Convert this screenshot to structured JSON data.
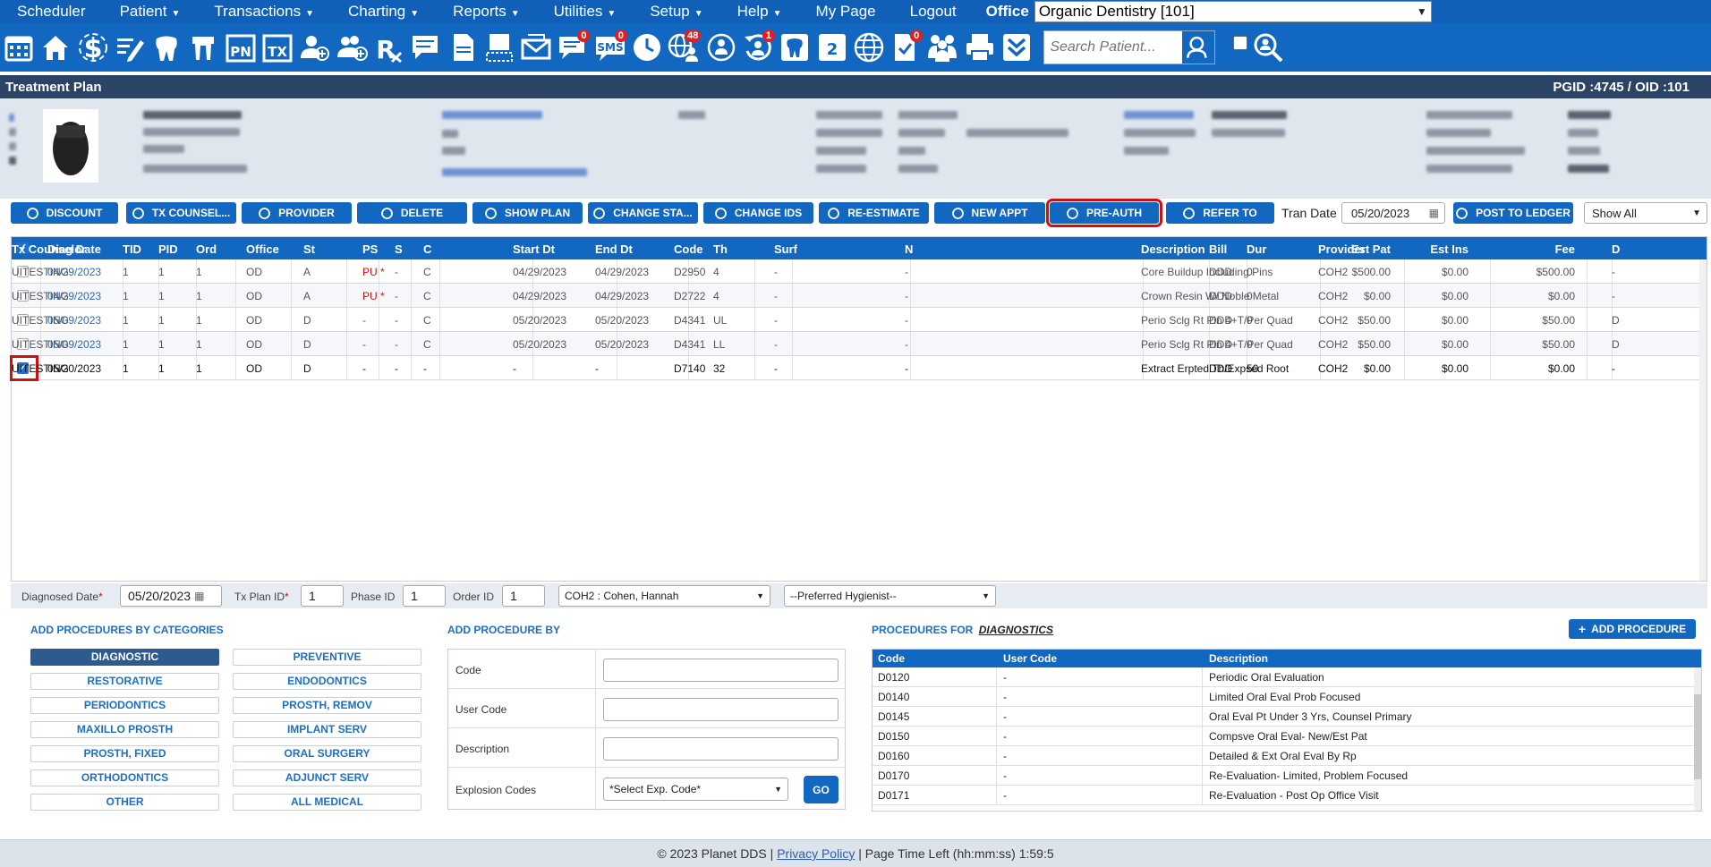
{
  "menu": {
    "items": [
      {
        "label": "Scheduler",
        "caret": false
      },
      {
        "label": "Patient",
        "caret": true
      },
      {
        "label": "Transactions",
        "caret": true
      },
      {
        "label": "Charting",
        "caret": true
      },
      {
        "label": "Reports",
        "caret": true
      },
      {
        "label": "Utilities",
        "caret": true
      },
      {
        "label": "Setup",
        "caret": true
      },
      {
        "label": "Help",
        "caret": true
      },
      {
        "label": "My Page",
        "caret": false
      },
      {
        "label": "Logout",
        "caret": false
      }
    ],
    "office_label": "Office",
    "office_value": "Organic Dentistry [101]"
  },
  "toolbar": {
    "icons": [
      "calendar-icon",
      "home-icon",
      "dollar-icon",
      "pencil-list-icon",
      "tooth-icon",
      "tooth-roots-icon",
      "pn-icon",
      "tx-icon",
      "add-patient-icon",
      "add-family-icon",
      "rx-icon",
      "notes-icon",
      "document-icon",
      "scan-icon",
      "mail-icon",
      "chat-icon",
      "sms-icon",
      "clock-icon",
      "globe-people-icon",
      "network-icon",
      "refresh-user-icon",
      "tooth-alt-icon",
      "tooth-2-icon",
      "globe-icon",
      "document-check-icon",
      "people-icon",
      "printer-icon",
      "chevron-down-icon"
    ],
    "badges": {
      "chat-icon": "0",
      "sms-icon": "0",
      "globe-people-icon": "48",
      "refresh-user-icon": "1",
      "document-check-icon": "0"
    },
    "search_placeholder": "Search Patient..."
  },
  "titlebar": {
    "title": "Treatment Plan",
    "ids": "PGID :4745  /  OID :101"
  },
  "actions": [
    {
      "name": "discount-button",
      "label": "DISCOUNT"
    },
    {
      "name": "tx-counselor-button",
      "label": "TX COUNSEL..."
    },
    {
      "name": "provider-button",
      "label": "PROVIDER"
    },
    {
      "name": "delete-button",
      "label": "DELETE"
    },
    {
      "name": "show-plan-button",
      "label": "SHOW PLAN"
    },
    {
      "name": "change-status-button",
      "label": "CHANGE STA..."
    },
    {
      "name": "change-ids-button",
      "label": "CHANGE IDS"
    },
    {
      "name": "re-estimate-button",
      "label": "RE-ESTIMATE"
    },
    {
      "name": "new-appt-button",
      "label": "NEW APPT"
    },
    {
      "name": "pre-auth-button",
      "label": "PRE-AUTH"
    },
    {
      "name": "refer-to-button",
      "label": "REFER TO"
    },
    {
      "name": "post-to-ledger-button",
      "label": "POST TO LEDGER"
    }
  ],
  "tran_date": {
    "label": "Tran Date",
    "value": "05/20/2023"
  },
  "show_filter": "Show All",
  "grid": {
    "headers": [
      "Diag Date",
      "TID",
      "PID",
      "Ord",
      "Office",
      "St",
      "PS",
      "S",
      "C",
      "Start Dt",
      "End Dt",
      "Code",
      "Th",
      "Surf",
      "N",
      "Description",
      "Bill",
      "Dur",
      "Provider",
      "Est Pat",
      "Est Ins",
      "Fee",
      "D",
      "Tx Counselor"
    ],
    "rows": [
      {
        "checked": false,
        "cells": [
          "04/29/2023",
          "1",
          "1",
          "1",
          "OD",
          "A",
          "PU *",
          "-",
          "C",
          "04/29/2023",
          "04/29/2023",
          "D2950",
          "4",
          "-",
          "-",
          "Core Buildup Including Pins",
          "DDD",
          "0",
          "COH2",
          "$500.00",
          "$0.00",
          "$500.00",
          "-",
          "UITESTING"
        ]
      },
      {
        "checked": false,
        "cells": [
          "04/29/2023",
          "1",
          "1",
          "1",
          "OD",
          "A",
          "PU *",
          "-",
          "C",
          "04/29/2023",
          "04/29/2023",
          "D2722",
          "4",
          "-",
          "-",
          "Crown Resin W/ Noble Metal",
          "DDD",
          "0",
          "COH2",
          "$0.00",
          "$0.00",
          "$0.00",
          "-",
          "UITESTING"
        ]
      },
      {
        "checked": false,
        "cells": [
          "05/09/2023",
          "1",
          "1",
          "1",
          "OD",
          "D",
          "-",
          "-",
          "C",
          "05/20/2023",
          "05/20/2023",
          "D4341",
          "UL",
          "-",
          "-",
          "Perio Sclg Rt Pln 4+T/Per Quad",
          "DDD",
          "0",
          "COH2",
          "$50.00",
          "$0.00",
          "$50.00",
          "D",
          "UITESTING"
        ]
      },
      {
        "checked": false,
        "cells": [
          "05/09/2023",
          "1",
          "1",
          "1",
          "OD",
          "D",
          "-",
          "-",
          "C",
          "05/20/2023",
          "05/20/2023",
          "D4341",
          "LL",
          "-",
          "-",
          "Perio Sclg Rt Pln 4+T/Per Quad",
          "DDD",
          "0",
          "COH2",
          "$50.00",
          "$0.00",
          "$50.00",
          "D",
          "UITESTING"
        ]
      },
      {
        "checked": true,
        "cells": [
          "05/20/2023",
          "1",
          "1",
          "1",
          "OD",
          "D",
          "-",
          "-",
          "-",
          "-",
          "-",
          "D7140",
          "32",
          "-",
          "-",
          "Extract Erpted Th/Expsed Root",
          "DDD",
          "50",
          "COH2",
          "$0.00",
          "$0.00",
          "$0.00",
          "-",
          "UITESTING"
        ]
      }
    ]
  },
  "form": {
    "diag_date_label": "Diagnosed Date",
    "diag_date": "05/20/2023",
    "tx_plan_label": "Tx Plan ID",
    "tx_plan": "1",
    "phase_label": "Phase ID",
    "phase": "1",
    "order_label": "Order ID",
    "order": "1",
    "provider": "COH2 : Cohen, Hannah",
    "hygienist": "--Preferred Hygienist--"
  },
  "categories": {
    "title": "ADD PROCEDURES BY CATEGORIES",
    "left": [
      "DIAGNOSTIC",
      "RESTORATIVE",
      "PERIODONTICS",
      "MAXILLO PROSTH",
      "PROSTH, FIXED",
      "ORTHODONTICS",
      "OTHER"
    ],
    "right": [
      "PREVENTIVE",
      "ENDODONTICS",
      "PROSTH, REMOV",
      "IMPLANT SERV",
      "ORAL SURGERY",
      "ADJUNCT SERV",
      "ALL MEDICAL"
    ]
  },
  "addby": {
    "title": "ADD PROCEDURE BY",
    "code_label": "Code",
    "user_code_label": "User Code",
    "description_label": "Description",
    "explosion_label": "Explosion Codes",
    "explosion_value": "*Select Exp. Code*",
    "go_label": "GO"
  },
  "procedures": {
    "title_prefix": "PROCEDURES FOR",
    "title_category": "DIAGNOSTICS",
    "add_label": "ADD PROCEDURE",
    "headers": [
      "Code",
      "User Code",
      "Description"
    ],
    "rows": [
      [
        "D0120",
        "-",
        "Periodic Oral Evaluation"
      ],
      [
        "D0140",
        "-",
        "Limited Oral Eval Prob Focused"
      ],
      [
        "D0145",
        "-",
        "Oral Eval Pt Under 3 Yrs, Counsel Primary"
      ],
      [
        "D0150",
        "-",
        "Compsve Oral Eval- New/Est Pat"
      ],
      [
        "D0160",
        "-",
        "Detailed & Ext Oral Eval By Rp"
      ],
      [
        "D0170",
        "-",
        "Re-Evaluation- Limited, Problem Focused"
      ],
      [
        "D0171",
        "-",
        "Re-Evaluation - Post Op Office Visit"
      ]
    ]
  },
  "footer": {
    "copyright": "© 2023 Planet DDS |",
    "privacy": "Privacy Policy",
    "time_left": "|  Page Time Left (hh:mm:ss) 1:59:5"
  },
  "colors": {
    "primary": "#1267c0",
    "title_bar": "#2b4466",
    "highlight": "#d01010",
    "link": "#2c6bb3"
  }
}
